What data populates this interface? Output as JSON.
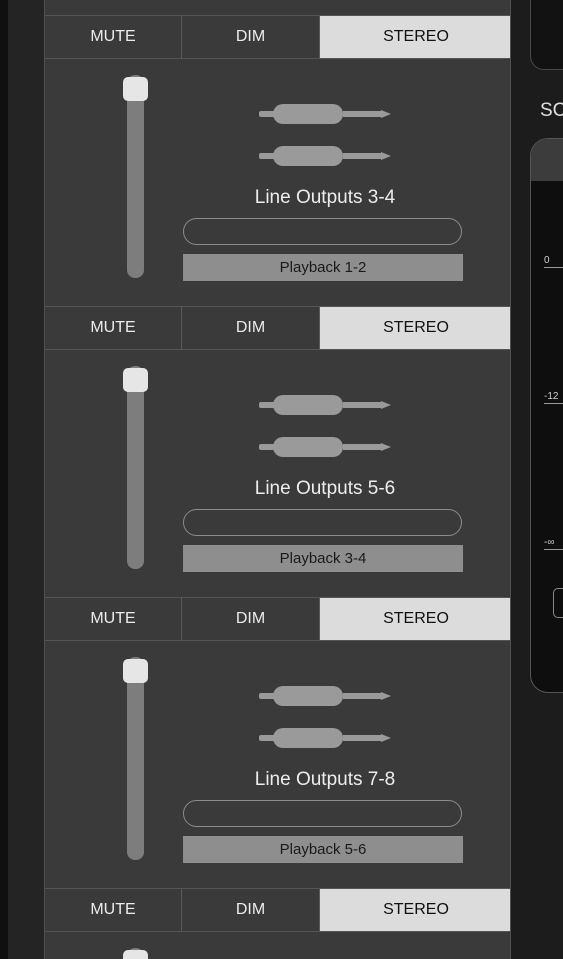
{
  "buttons": {
    "mute": "MUTE",
    "dim": "DIM",
    "stereo": "STEREO"
  },
  "channels": [
    {
      "name": "Line Outputs 3-4",
      "source": "Playback 1-2",
      "fader_level": 1.0
    },
    {
      "name": "Line Outputs 5-6",
      "source": "Playback 3-4",
      "fader_level": 1.0
    },
    {
      "name": "Line Outputs 7-8",
      "source": "Playback 5-6",
      "fader_level": 1.0
    }
  ],
  "right_panel": {
    "section_label": "SC",
    "meter_marks": [
      "0",
      "-12",
      "-∞"
    ]
  },
  "colors": {
    "panel": "#3a3a3a",
    "stereo_active": "#dcdcdc",
    "source_bar": "#8e8e8e",
    "fader_track": "#7d7d7d",
    "fader_knob": "#e6e6e6"
  },
  "icons": {
    "output_jack": "jack-plug-icon"
  }
}
